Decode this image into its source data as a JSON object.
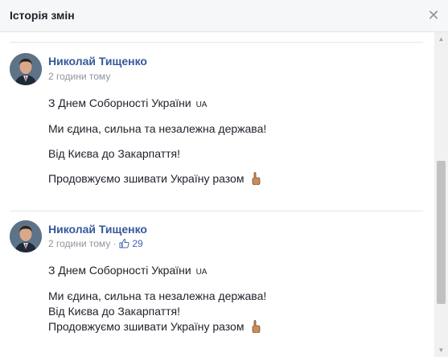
{
  "dialog": {
    "title": "Історія змін",
    "close_icon": "close-icon"
  },
  "posts": [
    {
      "author": "Николай Тищенко",
      "time": "2 години тому",
      "lines": [
        "З Днем Соборності України",
        "Ми єдина, сильна та незалежна держава!",
        "Від Києва до Закарпаття!",
        "Продовжуємо зшивати Україну разом"
      ],
      "flag": "UA"
    },
    {
      "author": "Николай Тищенко",
      "time": "2 години тому",
      "separator": "·",
      "likes": "29",
      "lines": [
        "З Днем Соборності України",
        "Ми єдина, сильна та незалежна держава!",
        "Від Києва до Закарпаття!",
        "Продовжуємо зшивати Україну разом"
      ],
      "flag": "UA"
    }
  ],
  "icons": {
    "finger": "pointing-finger-icon",
    "like": "thumbs-up-icon"
  }
}
